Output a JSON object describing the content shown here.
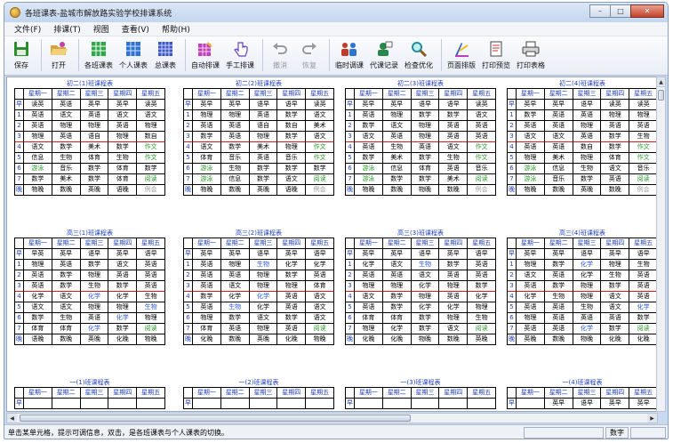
{
  "window": {
    "title": "各班课表-盐城市解放路实验学校排课系统"
  },
  "window_controls": {
    "minimize": "–",
    "maximize": "□",
    "close": "✕"
  },
  "menus": [
    "文件(F)",
    "排课(T)",
    "视图",
    "查看(V)",
    "帮助(H)"
  ],
  "toolbar": [
    {
      "label": "保存",
      "icon": "floppy-disk-icon",
      "color": "#2f8f2f",
      "enabled": true
    },
    {
      "label": "打开",
      "icon": "open-folder-icon",
      "color": "#d9a23a",
      "enabled": true
    },
    {
      "label": "各班课表",
      "icon": "class-schedule-icon",
      "color": "#2fa84a",
      "enabled": true
    },
    {
      "label": "个人课表",
      "icon": "personal-schedule-icon",
      "color": "#2e74d0",
      "enabled": true
    },
    {
      "label": "总课表",
      "icon": "master-schedule-icon",
      "color": "#3b57c4",
      "enabled": true
    },
    {
      "label": "自动排课",
      "icon": "auto-schedule-icon",
      "color": "#c03fb8",
      "enabled": true
    },
    {
      "label": "手工排课",
      "icon": "hand-cursor-icon",
      "color": "#6a3fc0",
      "enabled": true
    },
    {
      "label": "撤消",
      "icon": "undo-icon",
      "color": "#9a9a9a",
      "enabled": false
    },
    {
      "label": "恢复",
      "icon": "redo-icon",
      "color": "#9a9a9a",
      "enabled": false
    },
    {
      "label": "临时调课",
      "icon": "people-swap-icon",
      "color": "#c0392b",
      "enabled": true
    },
    {
      "label": "代课记录",
      "icon": "substitute-record-icon",
      "color": "#27884a",
      "enabled": true
    },
    {
      "label": "检查优化",
      "icon": "magnifier-icon",
      "color": "#1f8f9a",
      "enabled": true
    },
    {
      "label": "页面排版",
      "icon": "page-layout-icon",
      "color": "#2554c7",
      "enabled": true
    },
    {
      "label": "打印预览",
      "icon": "print-preview-icon",
      "color": "#444444",
      "enabled": true
    },
    {
      "label": "打印表格",
      "icon": "printer-icon",
      "color": "#444444",
      "enabled": true
    }
  ],
  "days": [
    "星期一",
    "星期二",
    "星期三",
    "星期四",
    "星期五"
  ],
  "row_labels": [
    "早",
    "1",
    "2",
    "3",
    "4",
    "5",
    "6",
    "7",
    "晚"
  ],
  "schedules": [
    {
      "title": "初二(1)班课程表",
      "rows": [
        [
          "读英",
          "英语",
          "英早",
          "英早",
          "读英"
        ],
        [
          "英语",
          "语文",
          "英语",
          "语文",
          "语文"
        ],
        [
          "英语",
          "物理",
          "物理",
          "英语",
          "物理"
        ],
        [
          "物理",
          "英语",
          "语自",
          "物理",
          "数自"
        ],
        [
          "语文",
          "数学",
          "美术",
          "数学",
          "作文"
        ],
        [
          "信息",
          "生物",
          "体育",
          "生物",
          "作文"
        ],
        [
          "游泳",
          "音乐",
          "数学",
          "体育",
          "数学"
        ],
        [
          "数学",
          "美术",
          "数学",
          "体育",
          "阅读"
        ],
        [
          "物晚",
          "数晚",
          "英晚",
          "语晚",
          "例会"
        ]
      ]
    },
    {
      "title": "初二(2)班课程表",
      "rows": [
        [
          "英早",
          "英早",
          "语早",
          "语早",
          "读英"
        ],
        [
          "物理",
          "物理",
          "英语",
          "数学",
          "语文"
        ],
        [
          "英语",
          "英语",
          "语自",
          "数自",
          "美术"
        ],
        [
          "数学",
          "英语",
          "物理",
          "数学",
          "语文"
        ],
        [
          "语文",
          "数学",
          "美术",
          "物理",
          "作文"
        ],
        [
          "体育",
          "音乐",
          "英语",
          "音乐",
          "作文"
        ],
        [
          "游泳",
          "生物",
          "数学",
          "数学",
          "数学"
        ],
        [
          "游泳",
          "信息",
          "数学",
          "语文",
          "阅读"
        ],
        [
          "物晚",
          "数晚",
          "英晚",
          "语晚",
          "例会"
        ]
      ]
    },
    {
      "title": "初二(3)班课程表",
      "rows": [
        [
          "英早",
          "英早",
          "语早",
          "语早",
          "读英"
        ],
        [
          "英语",
          "物理",
          "数学",
          "数学",
          "语文"
        ],
        [
          "数学",
          "语文",
          "物理",
          "英语",
          "英语"
        ],
        [
          "语文",
          "英语",
          "物理",
          "英语",
          "英语"
        ],
        [
          "英语",
          "生物",
          "英语",
          "语文",
          "作文"
        ],
        [
          "数学",
          "美术",
          "数学",
          "生物",
          "作文"
        ],
        [
          "游泳",
          "信息",
          "体育",
          "英语",
          "音乐"
        ],
        [
          "游泳",
          "数学",
          "数学",
          "美术",
          "阅读"
        ],
        [
          "物晚",
          "数晚",
          "物晚",
          "数晚",
          "例会"
        ]
      ]
    },
    {
      "title": "初二(4)班课程表",
      "rows": [
        [
          "英早",
          "英早",
          "语早",
          "读英",
          "读英"
        ],
        [
          "数学",
          "英语",
          "英语",
          "物理",
          "物理"
        ],
        [
          "英语",
          "英语",
          "物理",
          "英语",
          "英语"
        ],
        [
          "语文",
          "语文",
          "英语",
          "数学",
          "生物"
        ],
        [
          "英语",
          "英语",
          "数自",
          "数学",
          "作文"
        ],
        [
          "物理",
          "美术",
          "物理",
          "体育",
          "作文"
        ],
        [
          "游泳",
          "信息",
          "生物",
          "语文",
          "音乐"
        ],
        [
          "游泳",
          "音乐",
          "数学",
          "英语",
          "阅读"
        ],
        [
          "物晚",
          "数晚",
          "英晚",
          "数晚",
          "例会"
        ]
      ]
    },
    {
      "title": "高三(1)班课程表",
      "rows": [
        [
          "早英",
          "英早",
          "语早",
          "英早",
          "语早"
        ],
        [
          "物理",
          "英语",
          "数学",
          "语文",
          "英语"
        ],
        [
          "英语",
          "数学",
          "物理",
          "英语",
          "英语"
        ],
        [
          "英语",
          "数学",
          "生物",
          "数学",
          "英语"
        ],
        [
          "化学",
          "语文",
          "化学",
          "化学",
          "生物"
        ],
        [
          "语文",
          "语文",
          "物理",
          "物理",
          "生物"
        ],
        [
          "数学",
          "生物",
          "英语",
          "化学",
          "物理"
        ],
        [
          "体育",
          "体育",
          "化学",
          "数学",
          "阅读"
        ],
        [
          "语晚",
          "数晚",
          "英晚",
          "化晚",
          "物晚"
        ]
      ]
    },
    {
      "title": "高三(2)班课程表",
      "rows": [
        [
          "英早",
          "英早",
          "语早",
          "英早",
          "语早"
        ],
        [
          "英语",
          "物理",
          "生物",
          "化学",
          "化学"
        ],
        [
          "英语",
          "英语",
          "物理",
          "数学",
          "英语"
        ],
        [
          "英语",
          "语文",
          "物理",
          "物理",
          "体育"
        ],
        [
          "数学",
          "化学",
          "化学",
          "英语",
          "语文"
        ],
        [
          "英语",
          "生物",
          "化学",
          "英语",
          "语文"
        ],
        [
          "物理",
          "数学",
          "语文",
          "数学",
          "语文"
        ],
        [
          "体育",
          "英语",
          "物理",
          "英语",
          "阅读"
        ],
        [
          "化晚",
          "数晚",
          "英晚",
          "化晚",
          "物晚"
        ]
      ]
    },
    {
      "title": "高三(3)班课程表",
      "rows": [
        [
          "英早",
          "英早",
          "语早",
          "英早",
          "语早"
        ],
        [
          "化学",
          "语文",
          "生物",
          "数学",
          "英语"
        ],
        [
          "英语",
          "英语",
          "语文",
          "英语",
          "英语"
        ],
        [
          "物理",
          "物理",
          "化学",
          "物理",
          "数学"
        ],
        [
          "语文",
          "数学",
          "物理",
          "英语",
          "化学"
        ],
        [
          "英语",
          "数学",
          "化学",
          "化学",
          "物理"
        ],
        [
          "体育",
          "体育",
          "数学",
          "物理",
          "生物"
        ],
        [
          "物理",
          "化学",
          "数学",
          "语文",
          "阅读"
        ],
        [
          "化晚",
          "化晚",
          "物晚",
          "数晚",
          "英晚"
        ]
      ]
    },
    {
      "title": "高三(4)班课程表",
      "rows": [
        [
          "英早",
          "英早",
          "语早",
          "英早",
          "语早"
        ],
        [
          "物理",
          "数学",
          "化学",
          "物理",
          "生物"
        ],
        [
          "语文",
          "英语",
          "化学",
          "生物",
          "英语"
        ],
        [
          "英语",
          "数学",
          "物理",
          "数学",
          "英语"
        ],
        [
          "化学",
          "生物",
          "物理",
          "语文",
          "英语"
        ],
        [
          "英语",
          "英语",
          "生物",
          "语文",
          "化学"
        ],
        [
          "物理",
          "英语",
          "英语",
          "英语",
          "数学"
        ],
        [
          "英语",
          "英语",
          "化学",
          "数学",
          "阅读"
        ],
        [
          "英晚",
          "数晚",
          "物晚",
          "化晚",
          "化晚"
        ]
      ]
    },
    {
      "title": "一(1)班课程表",
      "rows": [
        [
          "",
          "",
          "",
          "",
          ""
        ]
      ]
    },
    {
      "title": "一(2)班课程表",
      "rows": [
        [
          "",
          "",
          "",
          "",
          ""
        ]
      ]
    },
    {
      "title": "一(3)班课程表",
      "rows": [
        [
          "",
          "",
          "",
          "",
          ""
        ]
      ]
    },
    {
      "title": "一(4)班课程表",
      "rows": [
        [
          "",
          "英早",
          "语早",
          "英早",
          "英早"
        ]
      ]
    }
  ],
  "statusbar": {
    "message": "单击某单元格，提示可调信息，双击，是各班课表与个人课表的切换。",
    "indicator": "数字"
  }
}
